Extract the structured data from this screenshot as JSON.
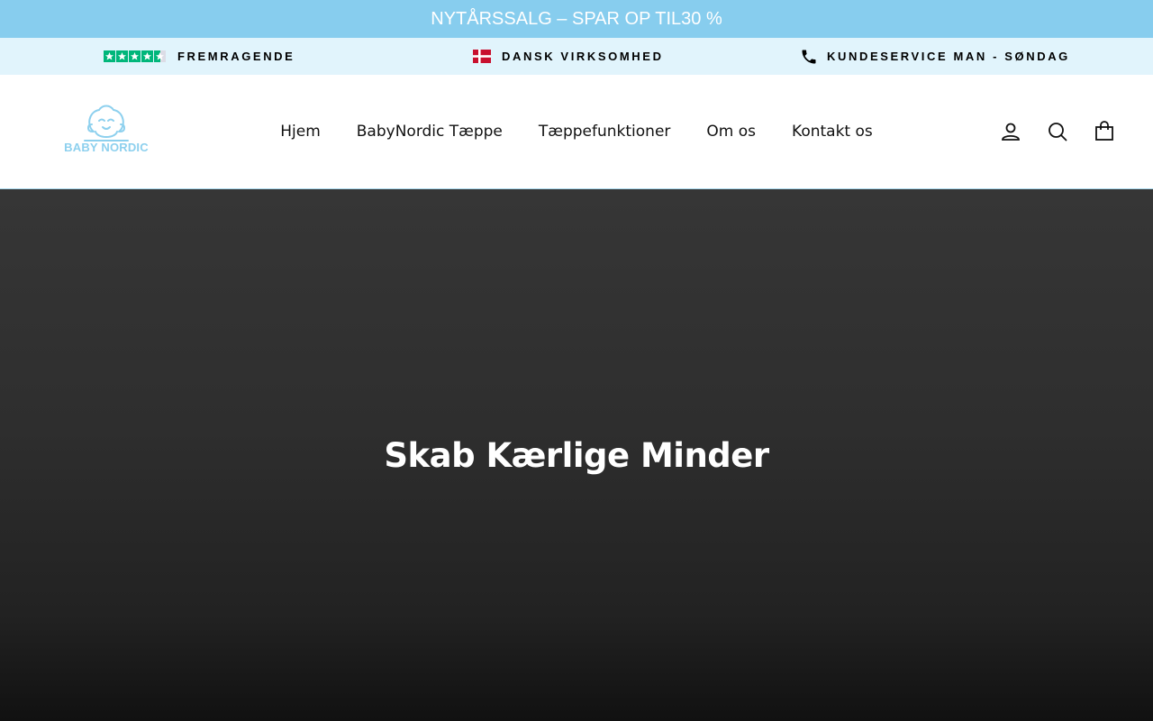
{
  "announcement": {
    "text": "NYTÅRSSALG – SPAR OP TIL30 %"
  },
  "usps": [
    {
      "icon": "trustpilot-stars-icon",
      "text": "FREMRAGENDE"
    },
    {
      "icon": "danish-flag-icon",
      "text": "DANSK VIRKSOMHED"
    },
    {
      "icon": "phone-icon",
      "text": "KUNDESERVICE MAN - SØNDAG"
    }
  ],
  "logo": {
    "text": "BABY NORDIC",
    "color": "#8dd0ee"
  },
  "nav": {
    "items": [
      {
        "label": "Hjem"
      },
      {
        "label": "BabyNordic Tæppe"
      },
      {
        "label": "Tæppefunktioner"
      },
      {
        "label": "Om os"
      },
      {
        "label": "Kontakt os"
      }
    ]
  },
  "header_icons": [
    "account-icon",
    "search-icon",
    "cart-icon"
  ],
  "hero": {
    "title": "Skab Kærlige Minder"
  },
  "colors": {
    "announcement_bg": "#87cdee",
    "usp_bg": "#e1f4fc",
    "trustpilot_green": "#00b67a",
    "flag_red": "#c8102e"
  }
}
